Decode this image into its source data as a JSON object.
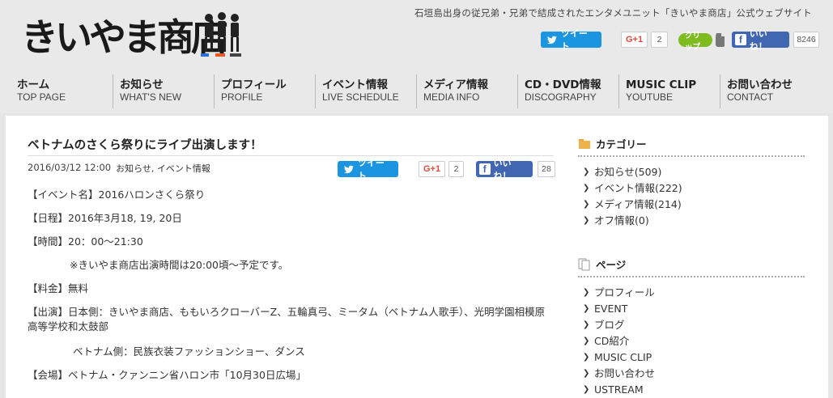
{
  "site": {
    "logo_text": "きいやま商店",
    "tagline": "石垣島出身の従兄弟・兄弟で結成されたエンタメユニット「きいやま商店」公式ウェブサイト"
  },
  "header_social": {
    "tweet_label": "ツイート",
    "gplus_label": "G+1",
    "gplus_count": "2",
    "clip_label": "クリップ",
    "fb_label": "いいね！",
    "fb_count": "8246"
  },
  "nav": [
    {
      "jp": "ホーム",
      "en": "TOP PAGE"
    },
    {
      "jp": "お知らせ",
      "en": "WHAT'S NEW"
    },
    {
      "jp": "プロフィール",
      "en": "PROFILE"
    },
    {
      "jp": "イベント情報",
      "en": "LIVE SCHEDULE"
    },
    {
      "jp": "メディア情報",
      "en": "MEDIA INFO"
    },
    {
      "jp": "CD・DVD情報",
      "en": "DISCOGRAPHY"
    },
    {
      "jp": "MUSIC CLIP",
      "en": "YOUTUBE"
    },
    {
      "jp": "お問い合わせ",
      "en": "CONTACT"
    }
  ],
  "post": {
    "title": "ベトナムのさくら祭りにライブ出演します！",
    "date": "2016/03/12 12:00",
    "cat1": "お知らせ",
    "sep": ",",
    "cat2": "イベント情報",
    "social": {
      "tweet_label": "ツイート",
      "gplus_label": "G+1",
      "gplus_count": "2",
      "fb_label": "いいね！",
      "fb_count": "28"
    },
    "lines": {
      "event_name": "【イベント名】2016ハロンさくら祭り",
      "dates": "【日程】2016年3月18, 19, 20日",
      "time": "【時間】20：00～21:30",
      "time_note": "※きいやま商店出演時間は20:00頃～予定です。",
      "fee": "【料金】無料",
      "performers": "【出演】日本側：きいやま商店、ももいろクローバーZ、五輪真弓、ミータム（ベトナム人歌手）、光明学園相模原高等学校和太鼓部",
      "performers_vn": "ベトナム側：民族衣装ファッションショー、ダンス",
      "venue": "【会場】ベトナム・クァンニン省ハロン市「10月30日広場」"
    }
  },
  "sidebar": {
    "categories_title": "カテゴリー",
    "categories": [
      "お知らせ(509)",
      "イベント情報(222)",
      "メディア情報(214)",
      "オフ情報(0)"
    ],
    "pages_title": "ページ",
    "pages": [
      "プロフィール",
      "EVENT",
      "ブログ",
      "CD紹介",
      "MUSIC CLIP",
      "お問い合わせ",
      "USTREAM"
    ]
  }
}
